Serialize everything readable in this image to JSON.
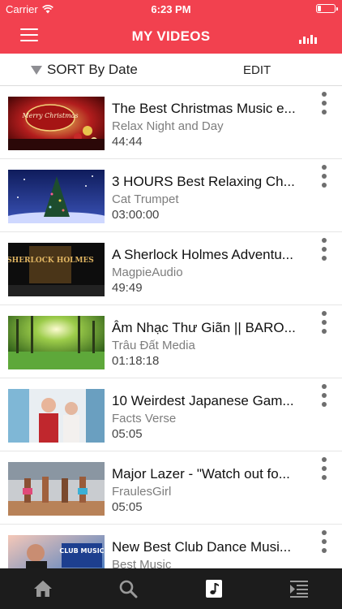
{
  "status_bar": {
    "carrier": "Carrier",
    "time": "6:23 PM",
    "battery_level": 0.2
  },
  "nav": {
    "title": "MY VIDEOS",
    "left_icon": "menu-icon",
    "right_icon": "equalizer-icon"
  },
  "toolbar": {
    "sort_label": "SORT By Date",
    "edit_label": "EDIT"
  },
  "videos": [
    {
      "title": "The Best Christmas Music e...",
      "channel": "Relax Night and Day",
      "duration": "44:44",
      "thumb_text": "Merry Christmas"
    },
    {
      "title": "3 HOURS Best Relaxing Ch...",
      "channel": "Cat Trumpet",
      "duration": "03:00:00"
    },
    {
      "title": "A Sherlock Holmes Adventu...",
      "channel": "MagpieAudio",
      "duration": "49:49",
      "thumb_text": "SHERLOCK HOLMES"
    },
    {
      "title": "Âm Nhạc Thư Giãn || BARO...",
      "channel": "Trâu Đất Media",
      "duration": "01:18:18"
    },
    {
      "title": "10 Weirdest Japanese Gam...",
      "channel": "Facts Verse",
      "duration": "05:05"
    },
    {
      "title": "Major Lazer - \"Watch out fo...",
      "channel": "FraulesGirl",
      "duration": "05:05"
    },
    {
      "title": "New Best Club Dance Musi...",
      "channel": "Best Music",
      "duration": "",
      "thumb_text": "CLUB MUSIC"
    }
  ],
  "tabs": [
    {
      "name": "home-icon",
      "active": false
    },
    {
      "name": "search-icon",
      "active": false
    },
    {
      "name": "music-note-icon",
      "active": true
    },
    {
      "name": "playlist-icon",
      "active": false
    }
  ],
  "colors": {
    "accent": "#f2414f",
    "tabbar_bg": "#1c1c1c",
    "secondary_text": "#7d7d7d"
  }
}
